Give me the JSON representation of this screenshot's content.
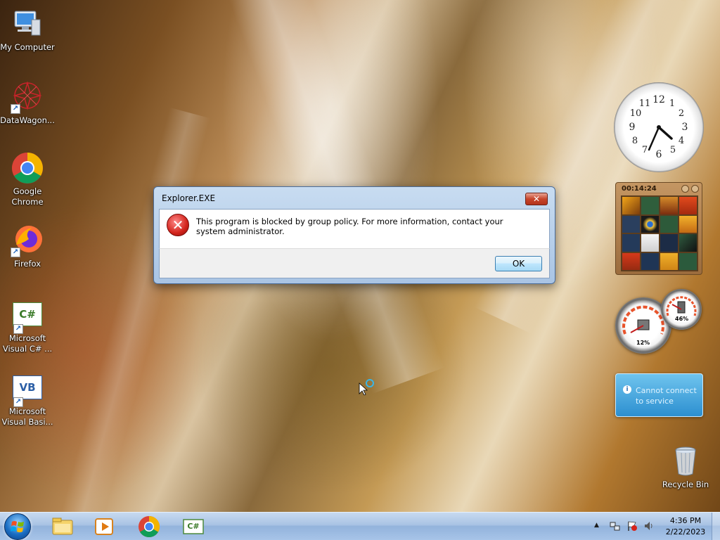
{
  "desktop": {
    "icons": [
      {
        "label": "My Computer",
        "icon": "computer-icon"
      },
      {
        "label": "DataWagon...",
        "icon": "datawagon-icon"
      },
      {
        "label": "Google Chrome",
        "icon": "chrome-icon"
      },
      {
        "label": "Firefox",
        "icon": "firefox-icon"
      },
      {
        "label": "Microsoft Visual C# ...",
        "icon": "visual-csharp-icon"
      },
      {
        "label": "Microsoft Visual Basi...",
        "icon": "visual-basic-icon"
      },
      {
        "label": "Recycle Bin",
        "icon": "recycle-bin-icon"
      }
    ],
    "csharp_glyph": "C#",
    "vb_glyph": "VB"
  },
  "dialog": {
    "title": "Explorer.EXE",
    "close_label": "✕",
    "message": "This program is blocked by group policy. For more information, contact your system administrator.",
    "ok_label": "OK",
    "icon": "error-icon"
  },
  "gadgets": {
    "clock": {
      "numbers": [
        "12",
        "1",
        "2",
        "3",
        "4",
        "5",
        "6",
        "7",
        "8",
        "9",
        "10",
        "11"
      ],
      "time": "4:36"
    },
    "puzzle": {
      "timer": "00:14:24"
    },
    "meters": {
      "cpu": "12%",
      "memory": "46%"
    },
    "weather": {
      "message": "Cannot connect to service"
    }
  },
  "taskbar": {
    "start_icon": "windows-logo-icon",
    "items": [
      "file-explorer-icon",
      "media-player-icon",
      "chrome-icon",
      "visual-csharp-icon"
    ],
    "tray": {
      "time": "4:36 PM",
      "date": "2/22/2023"
    }
  },
  "colors": {
    "dialog_frame": "#a9c4e4",
    "close_button": "#c7452b",
    "error": "#d2231b",
    "taskbar": "#a9c3e4"
  }
}
